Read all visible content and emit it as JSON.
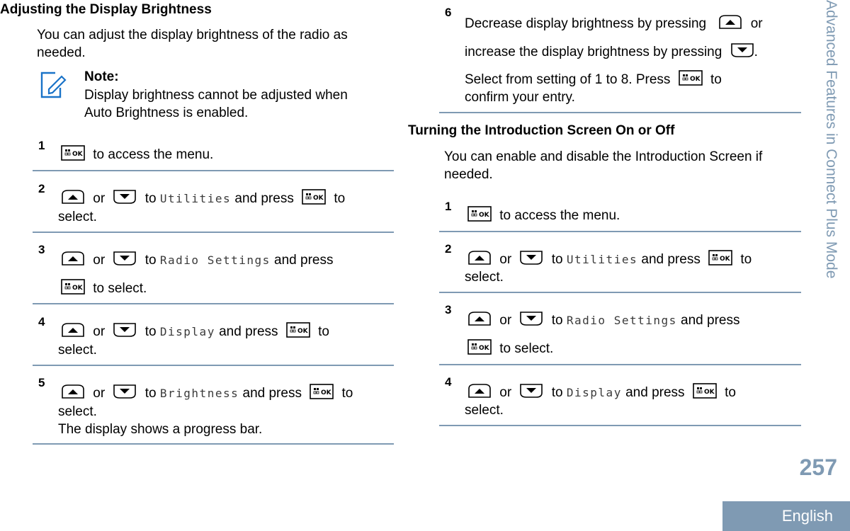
{
  "sidebar": {
    "section_title": "Advanced Features in Connect Plus Mode"
  },
  "footer": {
    "page_number": "257",
    "language": "English"
  },
  "colors": {
    "accent": "#7f9ab3",
    "note_icon": "#1a73c8"
  },
  "left_section": {
    "title": "Adjusting the Display Brightness",
    "intro": "You can adjust the display brightness of the radio as needed.",
    "intro_lines": [
      "You can adjust the display brightness of the radio as",
      "needed."
    ],
    "note": {
      "icon": "note-pencil-icon",
      "title": "Note:",
      "lines": [
        "Display brightness cannot be adjusted when",
        "Auto Brightness is enabled."
      ]
    },
    "steps": [
      {
        "number": "1",
        "text_after_key": "to access the menu."
      },
      {
        "number": "2",
        "or": "or",
        "to": "to",
        "menu_item": "Utilities",
        "and_press": "and press",
        "to_end": "to",
        "line2": "select."
      },
      {
        "number": "3",
        "or": "or",
        "to": "to",
        "menu_item": "Radio Settings",
        "and_press": "and press",
        "line2": "to select."
      },
      {
        "number": "4",
        "or": "or",
        "to": "to",
        "menu_item": "Display",
        "and_press": "and press",
        "to_end": "to",
        "line2": "select."
      },
      {
        "number": "5",
        "or": "or",
        "to": "to",
        "menu_item": "Brightness",
        "and_press": "and press",
        "to_end": "to",
        "line2": "select.",
        "line3": "The display shows a progress bar."
      }
    ]
  },
  "right_section": {
    "step6": {
      "number": "6",
      "line1": "Decrease display brightness by pressing",
      "line1_end": "or",
      "line2": "increase the display brightness by pressing",
      "line2_end": ".",
      "line3": "Select from setting of 1 to 8. Press",
      "line3_end": "to",
      "line4": "confirm your entry."
    },
    "title": "Turning the Introduction Screen On or Off",
    "intro_lines": [
      "You can enable and disable the Introduction Screen if",
      "needed."
    ],
    "steps": [
      {
        "number": "1",
        "text_after_key": "to access the menu."
      },
      {
        "number": "2",
        "or": "or",
        "to": "to",
        "menu_item": "Utilities",
        "and_press": "and press",
        "to_end": "to",
        "line2": "select."
      },
      {
        "number": "3",
        "or": "or",
        "to": "to",
        "menu_item": "Radio Settings",
        "and_press": "and press",
        "line2": "to select."
      },
      {
        "number": "4",
        "or": "or",
        "to": "to",
        "menu_item": "Display",
        "and_press": "and press",
        "to_end": "to",
        "line2": "select."
      }
    ]
  },
  "icons": {
    "up": "up-arrow-key-icon",
    "down": "down-arrow-key-icon",
    "ok": "menu-ok-key-icon"
  }
}
